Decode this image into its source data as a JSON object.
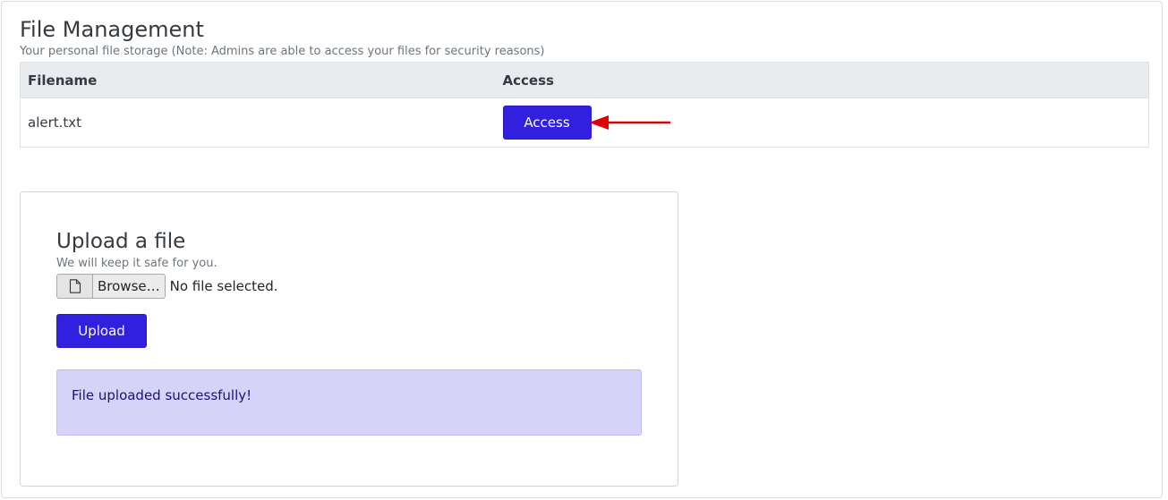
{
  "header": {
    "title": "File Management",
    "subtitle": "Your personal file storage (Note: Admins are able to access your files for security reasons)"
  },
  "table": {
    "columns": [
      "Filename",
      "Access"
    ],
    "rows": [
      {
        "filename": "alert.txt",
        "action_label": "Access"
      }
    ]
  },
  "upload": {
    "title": "Upload a file",
    "subtitle": "We will keep it safe for you.",
    "browse_label": "Browse…",
    "file_status": "No file selected.",
    "submit_label": "Upload",
    "alert_message": "File uploaded successfully!"
  },
  "annotation": {
    "arrow_icon": "arrow-left-icon",
    "arrow_color": "#e00000"
  },
  "colors": {
    "primary": "#3120dd",
    "alert_bg": "#d6d2f8",
    "alert_text": "#1d1275"
  }
}
